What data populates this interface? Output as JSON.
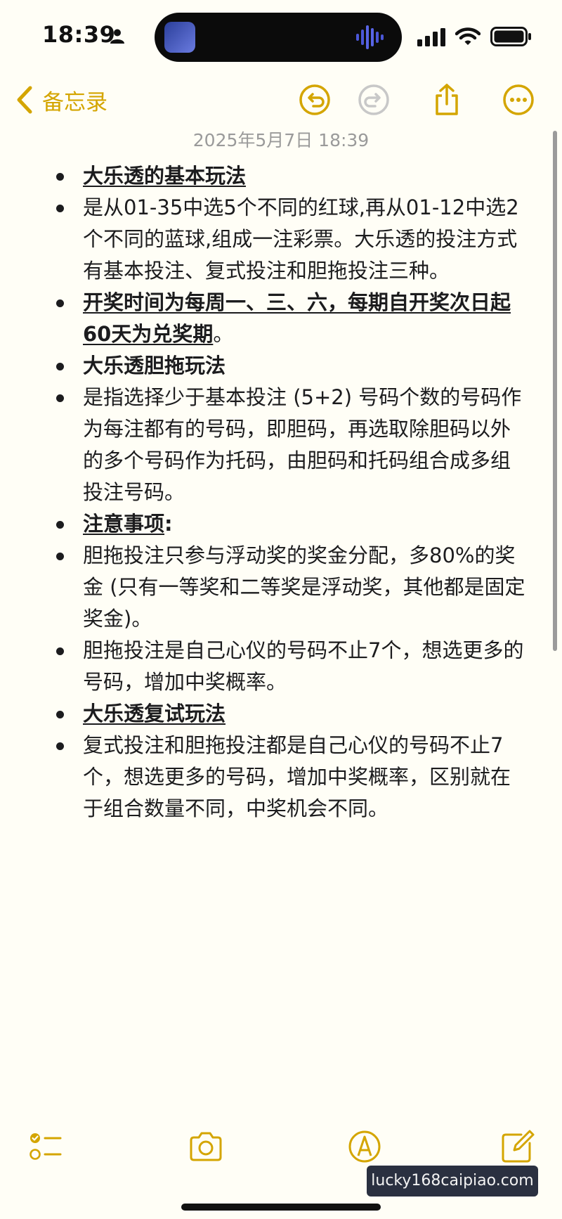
{
  "status_bar": {
    "time": "18:39"
  },
  "nav": {
    "back_label": "备忘录"
  },
  "note": {
    "date": "2025年5月7日 18:39",
    "items": [
      "大乐透的基本玩法",
      "是从01-35中选5个不同的红球,再从01-12中选2个不同的蓝球,组成一注彩票。大乐透的投注方式有基本投注、复式投注和胆拖投注三种。",
      "开奖时间为每周一、三、六，每期自开奖次日起60天为兑奖期",
      "。",
      "大乐透胆拖玩法",
      "是指选择少于基本投注 (5+2) 号码个数的号码作为每注都有的号码，即胆码，再选取除胆码以外的多个号码作为托码，由胆码和托码组合成多组投注号码。",
      "注意事项",
      ":",
      "胆拖投注只参与浮动奖的奖金分配，多80%的奖金 (只有一等奖和二等奖是浮动奖，其他都是固定奖金)。",
      "胆拖投注是自己心仪的号码不止7个，想选更多的号码，增加中奖概率。",
      "大乐透复试玩法",
      "复式投注和胆拖投注都是自己心仪的号码不止7个，想选更多的号码，增加中奖概率，区别就在于组合数量不同，中奖机会不同。"
    ]
  },
  "watermark": {
    "text": "lucky168caipiao.com"
  },
  "colors": {
    "accent": "#d4a500",
    "background": "#fffef6",
    "text": "#1c1c1e",
    "date": "#9a9a9a"
  },
  "icons": {
    "status": [
      "person-icon",
      "signal-icon",
      "wifi-icon",
      "battery-icon"
    ],
    "nav": [
      "chevron-left-icon",
      "undo-icon",
      "redo-icon",
      "share-icon",
      "more-icon"
    ],
    "toolbar": [
      "checklist-icon",
      "camera-icon",
      "markup-icon",
      "compose-icon"
    ]
  }
}
